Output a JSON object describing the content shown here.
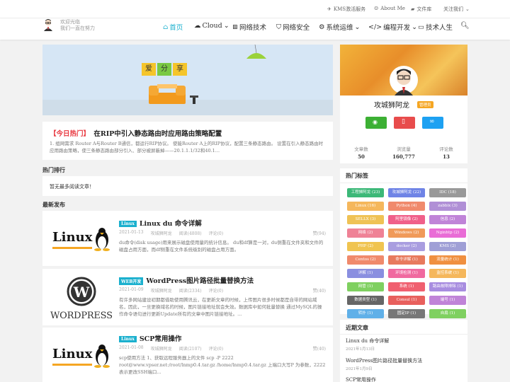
{
  "topbar": {
    "links": [
      "KMS激活服务",
      "About Me",
      "文件库",
      "关注我们"
    ]
  },
  "site": {
    "slogan1": "欢迎光临",
    "slogan2": "我们一直在努力"
  },
  "nav": [
    "首页",
    "Cloud",
    "网络技术",
    "网络安全",
    "系统运维",
    "编程开发",
    "技术人生"
  ],
  "banner": {
    "chars": [
      "爱",
      "分",
      "享"
    ]
  },
  "hot": {
    "tag": "【今日热门】",
    "title": "在RIP中引入静态路由时应用路由策略配置",
    "desc": "1. 组网需求 Router A与Router B通信，都运行RIP协议。 使能Router A上的RIP协议，配置三条静态路由。 设置在引入静态路由时应用路由策略，使三条静态路由部分引入、部分被屏蔽掉——20.1.1.1/32和40.1..."
  },
  "ranking": {
    "title": "热门排行",
    "empty": "暂无最多阅读文章！"
  },
  "latest": {
    "title": "最新发布"
  },
  "posts": [
    {
      "cat": "Linux",
      "title": "Linux du 命令详解",
      "date": "2021-01-13",
      "author": "攻城狮阿龙",
      "views": "阅读(4808)",
      "comments": "评论(0)",
      "likes": "赞(94)",
      "desc": "du命令(disk usage)用来展示磁盘使用量的统计信息。 du和df算是一对，du侧重在文件夹和文件的磁盘占用方面，而df侧重在文件系统级别的磁盘占用方面。",
      "thumb": "Linux"
    },
    {
      "cat": "WEB开发",
      "title": "WordPress图片路径批量替换方法",
      "date": "2021-01-09",
      "author": "攻城狮阿龙",
      "views": "阅读(2334)",
      "comments": "评论(0)",
      "likes": "赞(40)",
      "desc": "有许多网站建设初期都借助使用腾讯云，在更新文章的时候，上传图片很多时候都是自带的网站域名，因此，一旦更换域名的时候，图片链接地址就会失效。数据库中如何批量替换 通过MySQL的操作命令语句进行更新Update所有的文章中图片链接地址。...",
      "thumb": "WORDPRESS"
    },
    {
      "cat": "Linux",
      "title": "SCP常用操作",
      "date": "2021-01-08",
      "author": "攻城狮阿龙",
      "views": "阅读(2107)",
      "comments": "评论(0)",
      "likes": "赞(40)",
      "desc": "scp使用方法 1、获取远程服务器上的文件 scp -P 2222 root@www.vpser.net:/root/lnmp0.4.tar.gz /home/lnmp0.4.tar.gz 上端口大写P 为参数，2222 表示更改SSH端口...",
      "thumb": "Linux"
    }
  ],
  "profile": {
    "name": "攻城狮阿龙",
    "badge": "管理员",
    "stats": [
      {
        "label": "文章数",
        "value": "50"
      },
      {
        "label": "浏览量",
        "value": "160,777"
      },
      {
        "label": "评论数",
        "value": "13"
      }
    ]
  },
  "tags_title": "热门标签",
  "tags": [
    {
      "t": "工程狮阿龙 (23)",
      "c": "#3cb878"
    },
    {
      "t": "攻城狮阿龙 (22)",
      "c": "#6f84e6"
    },
    {
      "t": "IDC (18)",
      "c": "#999"
    },
    {
      "t": "Linux (16)",
      "c": "#f5b75c"
    },
    {
      "t": "Python (4)",
      "c": "#f08a6c"
    },
    {
      "t": "zabbix (3)",
      "c": "#b08fd6"
    },
    {
      "t": "SELLX (3)",
      "c": "#efc255"
    },
    {
      "t": "阿里镜像 (2)",
      "c": "#f0608a"
    },
    {
      "t": "信息 (2)",
      "c": "#c084d8"
    },
    {
      "t": "网络 (2)",
      "c": "#ef8296"
    },
    {
      "t": "Windows (2)",
      "c": "#f09a5a"
    },
    {
      "t": "Nginhtp (2)",
      "c": "#e96cd6"
    },
    {
      "t": "PHP (2)",
      "c": "#f0c450"
    },
    {
      "t": "docker (2)",
      "c": "#a99de0"
    },
    {
      "t": "KMS (2)",
      "c": "#9f9fd6"
    },
    {
      "t": "Centos (2)",
      "c": "#f08a6c"
    },
    {
      "t": "命令详解 (1)",
      "c": "#e87a5d"
    },
    {
      "t": "流量统计 (1)",
      "c": "#f09040"
    },
    {
      "t": "详解 (1)",
      "c": "#8a8fe0"
    },
    {
      "t": "环境检测 (1)",
      "c": "#f06aa0"
    },
    {
      "t": "监控系统 (1)",
      "c": "#f5b75c"
    },
    {
      "t": "网管 (1)",
      "c": "#7fd060"
    },
    {
      "t": "系统 (1)",
      "c": "#f06070"
    },
    {
      "t": "路由故障排除 (1)",
      "c": "#a88de0"
    },
    {
      "t": "数据类型 (1)",
      "c": "#666"
    },
    {
      "t": "Consul (1)",
      "c": "#e8605d"
    },
    {
      "t": "端号 (1)",
      "c": "#c084d8"
    },
    {
      "t": "转扑 (1)",
      "c": "#60b0e8"
    },
    {
      "t": "固定IP (1)",
      "c": "#777"
    },
    {
      "t": "自扇 (1)",
      "c": "#7fd060"
    }
  ],
  "recent": {
    "title": "近期文章",
    "items": [
      {
        "title": "Linux du 命令详解",
        "date": "2021年1月13日"
      },
      {
        "title": "WordPress图片路径批量替换方法",
        "date": "2021年1月9日"
      },
      {
        "title": "SCP常用操作",
        "date": ""
      }
    ]
  },
  "colors": {
    "accent": "#1bb0ce",
    "hot": "#e8363e"
  }
}
